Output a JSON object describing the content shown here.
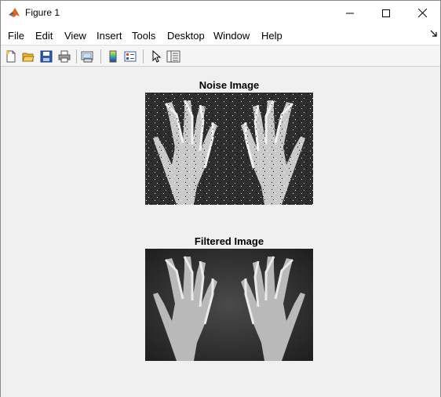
{
  "window": {
    "title": "Figure 1"
  },
  "menu": {
    "items": [
      "File",
      "Edit",
      "View",
      "Insert",
      "Tools",
      "Desktop",
      "Window",
      "Help"
    ]
  },
  "toolbar": {
    "icons": [
      "new-figure-icon",
      "open-file-icon",
      "save-icon",
      "print-icon",
      "link-plot-icon",
      "insert-colorbar-icon",
      "insert-legend-icon",
      "edit-plot-icon",
      "property-inspector-icon"
    ]
  },
  "plots": {
    "top_title": "Noise Image",
    "bottom_title": "Filtered Image"
  }
}
